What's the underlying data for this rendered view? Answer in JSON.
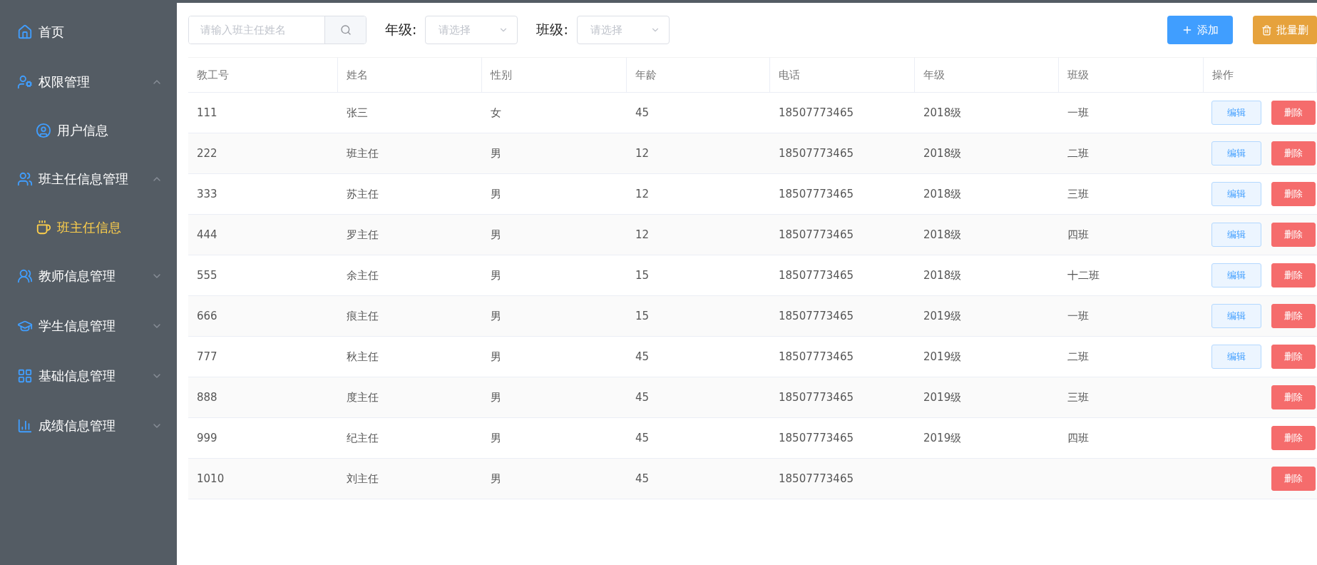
{
  "sidebar": {
    "items": [
      {
        "kind": "home",
        "label": "首页",
        "selected": false
      },
      {
        "kind": "permission",
        "label": "权限管理",
        "expanded": true,
        "selected": false,
        "children": [
          {
            "kind": "user",
            "label": "用户信息",
            "selected": false
          }
        ]
      },
      {
        "kind": "headteacher",
        "label": "班主任信息管理",
        "expanded": true,
        "selected": false,
        "children": [
          {
            "kind": "cup",
            "label": "班主任信息",
            "selected": true
          }
        ]
      },
      {
        "kind": "teacher",
        "label": "教师信息管理",
        "expanded": false,
        "selected": false
      },
      {
        "kind": "student",
        "label": "学生信息管理",
        "expanded": false,
        "selected": false
      },
      {
        "kind": "base",
        "label": "基础信息管理",
        "expanded": false,
        "selected": false
      },
      {
        "kind": "score",
        "label": "成绩信息管理",
        "expanded": false,
        "selected": false
      }
    ]
  },
  "toolbar": {
    "search": {
      "placeholder": "请输入班主任姓名"
    },
    "filters": [
      {
        "label": "年级:",
        "placeholder": "请选择"
      },
      {
        "label": "班级:",
        "placeholder": "请选择"
      }
    ],
    "buttons": [
      {
        "kind": "add",
        "label": "添加"
      },
      {
        "kind": "batch_delete",
        "label": "批量删"
      }
    ]
  },
  "table": {
    "columns": [
      "教工号",
      "姓名",
      "性别",
      "年龄",
      "电话",
      "年级",
      "班级",
      "操作"
    ],
    "rows": [
      {
        "cells": [
          "111",
          "张三",
          "女",
          "45",
          "18507773465",
          "2018级",
          "一班"
        ],
        "actions": [
          {
            "kind": "edit",
            "label": "编辑"
          },
          {
            "kind": "delete",
            "label": "删除"
          }
        ]
      },
      {
        "cells": [
          "222",
          "班主任",
          "男",
          "12",
          "18507773465",
          "2018级",
          "二班"
        ],
        "actions": [
          {
            "kind": "edit",
            "label": "编辑"
          },
          {
            "kind": "delete",
            "label": "删除"
          }
        ]
      },
      {
        "cells": [
          "333",
          "苏主任",
          "男",
          "12",
          "18507773465",
          "2018级",
          "三班"
        ],
        "actions": [
          {
            "kind": "edit",
            "label": "编辑"
          },
          {
            "kind": "delete",
            "label": "删除"
          }
        ]
      },
      {
        "cells": [
          "444",
          "罗主任",
          "男",
          "12",
          "18507773465",
          "2018级",
          "四班"
        ],
        "actions": [
          {
            "kind": "edit",
            "label": "编辑"
          },
          {
            "kind": "delete",
            "label": "删除"
          }
        ]
      },
      {
        "cells": [
          "555",
          "余主任",
          "男",
          "15",
          "18507773465",
          "2018级",
          "十二班"
        ],
        "actions": [
          {
            "kind": "edit",
            "label": "编辑"
          },
          {
            "kind": "delete",
            "label": "删除"
          }
        ]
      },
      {
        "cells": [
          "666",
          "痕主任",
          "男",
          "15",
          "18507773465",
          "2019级",
          "一班"
        ],
        "actions": [
          {
            "kind": "edit",
            "label": "编辑"
          },
          {
            "kind": "delete",
            "label": "删除"
          }
        ]
      },
      {
        "cells": [
          "777",
          "秋主任",
          "男",
          "45",
          "18507773465",
          "2019级",
          "二班"
        ],
        "actions": [
          {
            "kind": "edit",
            "label": "编辑"
          },
          {
            "kind": "delete",
            "label": "删除"
          }
        ]
      },
      {
        "cells": [
          "888",
          "度主任",
          "男",
          "45",
          "18507773465",
          "2019级",
          "三班"
        ],
        "actions": [
          {
            "kind": "delete",
            "label": "删除"
          }
        ]
      },
      {
        "cells": [
          "999",
          "纪主任",
          "男",
          "45",
          "18507773465",
          "2019级",
          "四班"
        ],
        "actions": [
          {
            "kind": "delete",
            "label": "删除"
          }
        ]
      },
      {
        "cells": [
          "1010",
          "刘主任",
          "男",
          "45",
          "18507773465"
        ],
        "actions": [
          {
            "kind": "delete",
            "label": "删除"
          }
        ]
      }
    ]
  }
}
